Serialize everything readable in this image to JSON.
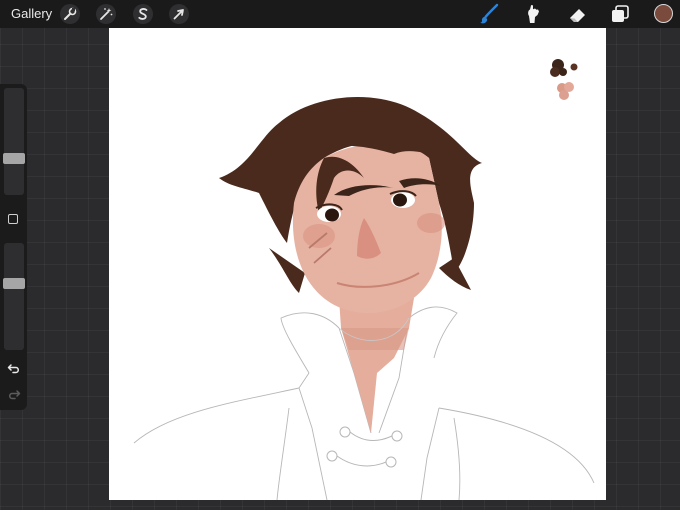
{
  "topbar": {
    "gallery_label": "Gallery",
    "left_tools": [
      {
        "name": "actions",
        "icon": "wrench-icon"
      },
      {
        "name": "adjustments",
        "icon": "magic-wand-icon"
      },
      {
        "name": "selection",
        "icon": "selection-s-icon"
      },
      {
        "name": "transform",
        "icon": "arrow-cursor-icon"
      }
    ],
    "right_tools": [
      {
        "name": "brush",
        "icon": "brush-icon",
        "active": true
      },
      {
        "name": "smudge",
        "icon": "smudge-icon",
        "active": false
      },
      {
        "name": "eraser",
        "icon": "eraser-icon",
        "active": false
      },
      {
        "name": "layers",
        "icon": "layers-icon",
        "active": false
      }
    ],
    "current_color": "#7a4a3c"
  },
  "sidebar": {
    "brush_size_icon": "brush-size-slider",
    "opacity_icon": "opacity-slider",
    "modify_icon": "square-outline-icon",
    "undo_icon": "undo-icon",
    "redo_icon": "redo-icon"
  },
  "canvas": {
    "background": "#ffffff",
    "palette": [
      "#3b2419",
      "#5a3322",
      "#d99a88",
      "#e3a898"
    ],
    "hair_color": "#4a2a1d",
    "skin_color": "#e6b3a3",
    "blush_color": "#d9907f",
    "accent_color": "#2f83d6"
  }
}
